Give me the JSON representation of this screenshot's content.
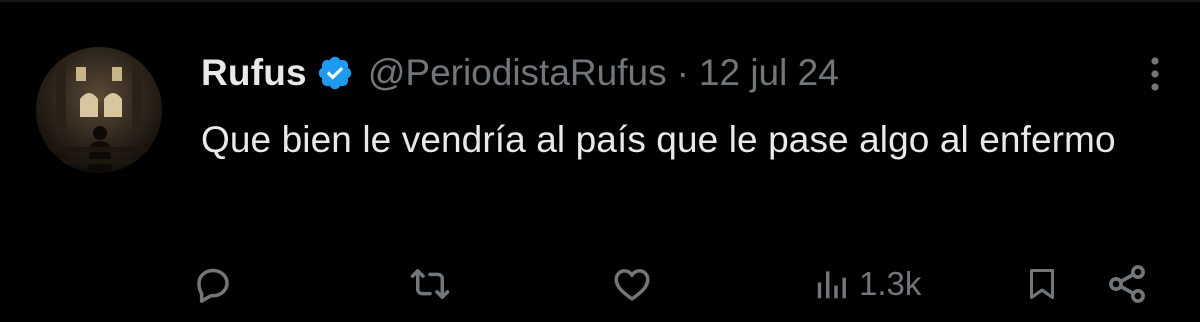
{
  "tweet": {
    "display_name": "Rufus",
    "handle": "@PeriodistaRufus",
    "separator": "·",
    "date": "12 jul 24",
    "text": "Que bien le vendría al país que le pase algo al enfermo",
    "views": "1.3k"
  },
  "icons": {
    "avatar": "church-interior-photo",
    "verified": "verified-badge-icon",
    "more": "more-vertical-icon",
    "reply": "reply-icon",
    "retweet": "retweet-icon",
    "like": "heart-icon",
    "views": "views-bar-chart-icon",
    "bookmark": "bookmark-icon",
    "share": "share-icon"
  },
  "colors": {
    "background": "#000000",
    "primary_text": "#e7e9ea",
    "secondary_text": "#71767b",
    "verified_blue": "#1d9bf0"
  }
}
